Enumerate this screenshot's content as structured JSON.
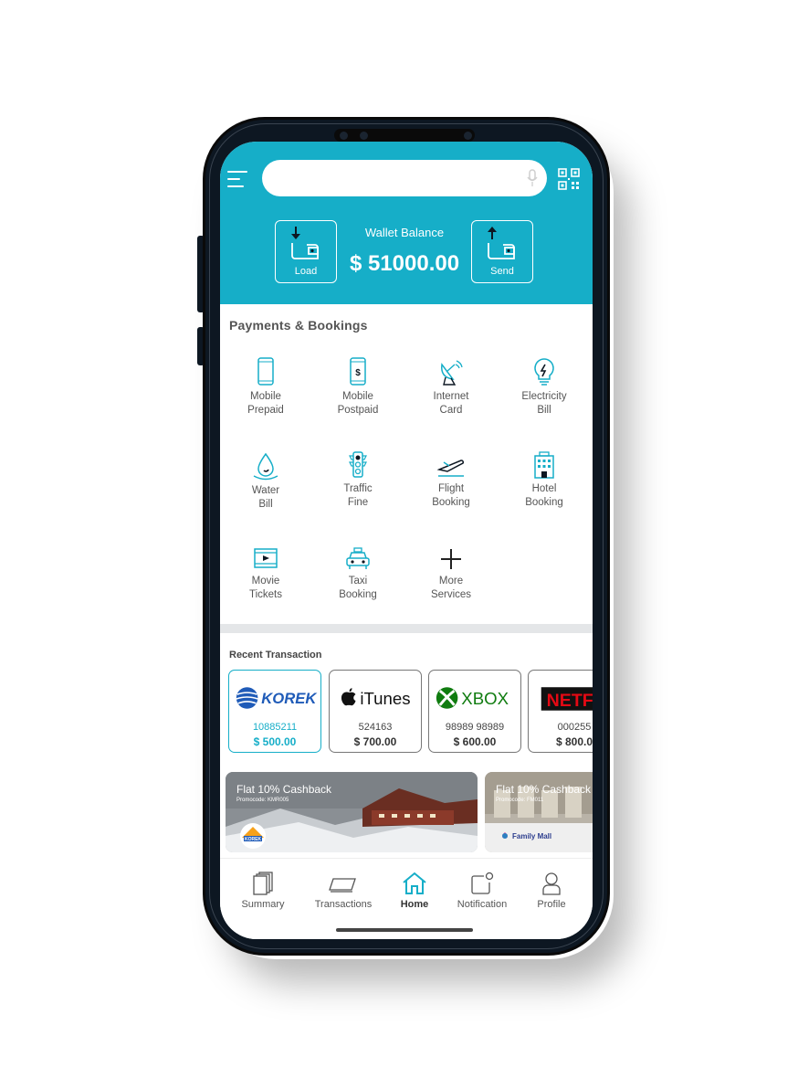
{
  "colors": {
    "accent": "#16aec8",
    "text_gray": "#555555",
    "band": "#e4e6e8"
  },
  "search": {
    "placeholder": "",
    "value": ""
  },
  "icons": {
    "menu": "hamburger-icon",
    "mic": "mic-icon",
    "qr": "qr-code-icon"
  },
  "wallet": {
    "balance_label": "Wallet Balance",
    "balance_amount": "$ 51000.00",
    "load_label": "Load",
    "send_label": "Send"
  },
  "payments": {
    "title": "Payments & Bookings",
    "items": [
      {
        "line1": "Mobile",
        "line2": "Prepaid",
        "icon": "mobile-phone-icon"
      },
      {
        "line1": "Mobile",
        "line2": "Postpaid",
        "icon": "mobile-dollar-icon"
      },
      {
        "line1": "Internet",
        "line2": "Card",
        "icon": "satellite-dish-icon"
      },
      {
        "line1": "Electricity",
        "line2": "Bill",
        "icon": "lightbulb-icon"
      },
      {
        "line1": "Water",
        "line2": "Bill",
        "icon": "water-drop-icon"
      },
      {
        "line1": "Traffic",
        "line2": "Fine",
        "icon": "traffic-light-icon"
      },
      {
        "line1": "Flight",
        "line2": "Booking",
        "icon": "airplane-icon"
      },
      {
        "line1": "Hotel",
        "line2": "Booking",
        "icon": "hotel-building-icon"
      },
      {
        "line1": "Movie",
        "line2": "Tickets",
        "icon": "film-icon"
      },
      {
        "line1": "Taxi",
        "line2": "Booking",
        "icon": "taxi-icon"
      },
      {
        "line1": "More",
        "line2": "Services",
        "icon": "plus-icon"
      }
    ]
  },
  "recent": {
    "title": "Recent Transaction",
    "items": [
      {
        "brand": "KOREK",
        "number": "10885211",
        "amount": "$ 500.00"
      },
      {
        "brand": "iTunes",
        "number": "524163",
        "amount": "$ 700.00"
      },
      {
        "brand": "XBOX",
        "number": "98989 98989",
        "amount": "$ 600.00"
      },
      {
        "brand": "NETFL",
        "number": "000255",
        "amount": "$ 800.0"
      }
    ]
  },
  "promos": [
    {
      "title": "Flat 10% Cashback",
      "code": "Promocode: KMR005",
      "logo": "KOREK"
    },
    {
      "title": "Flat 10% Cashback",
      "code": "Promocode: FM011",
      "logo": "Family Mall"
    }
  ],
  "nav": {
    "items": [
      {
        "label": "Summary",
        "icon": "summary-icon"
      },
      {
        "label": "Transactions",
        "icon": "card-icon"
      },
      {
        "label": "Home",
        "icon": "home-icon"
      },
      {
        "label": "Notification",
        "icon": "notification-icon"
      },
      {
        "label": "Profile",
        "icon": "profile-icon"
      }
    ],
    "active": "Home"
  }
}
